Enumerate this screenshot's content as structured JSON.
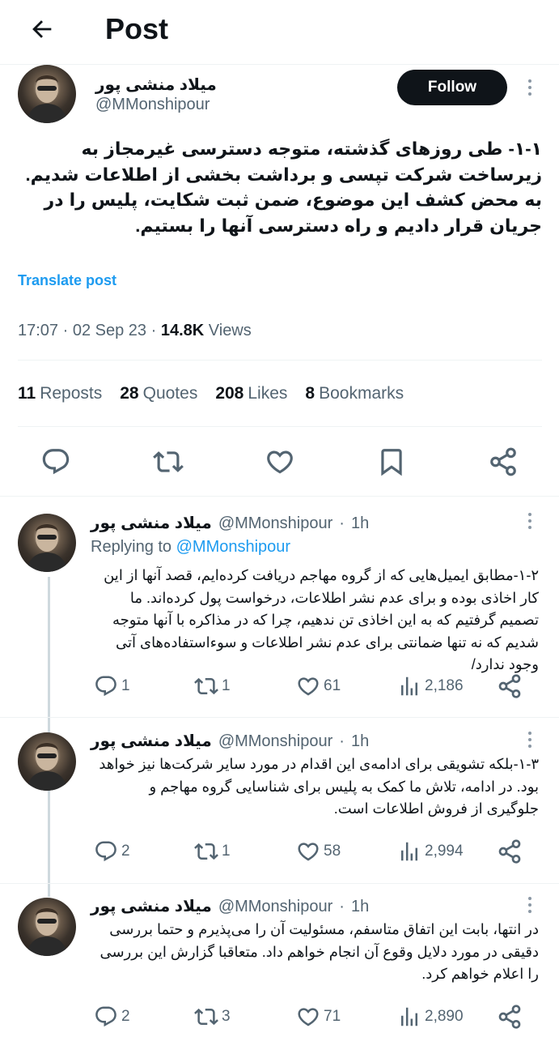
{
  "header": {
    "title": "Post",
    "back_icon": "arrow-left-icon"
  },
  "main_post": {
    "author_name": "میلاد منشی پور",
    "handle": "@MMonshipour",
    "follow_label": "Follow",
    "text": "۱-۱- طی روزهای گذشته، متوجه دسترسی غیرمجاز به زیرساخت شرکت تپسی و برداشت بخشی از اطلاعات شدیم. به محض کشف این موضوع، ضمن ثبت شکایت، پلیس را در جریان قرار دادیم و راه دسترسی آنها را بستیم.",
    "translate_label": "Translate post",
    "time": "17:07",
    "date": "02 Sep 23",
    "views_count": "14.8K",
    "views_label": "Views",
    "stats": {
      "reposts_count": "11",
      "reposts_label": "Reposts",
      "quotes_count": "28",
      "quotes_label": "Quotes",
      "likes_count": "208",
      "likes_label": "Likes",
      "bookmarks_count": "8",
      "bookmarks_label": "Bookmarks"
    }
  },
  "replies": [
    {
      "author_name": "میلاد منشی پور",
      "handle": "@MMonshipour",
      "age": "1h",
      "replying_label": "Replying to",
      "replying_handle": "@MMonshipour",
      "text": "۱-۲-مطابق ایمیل‌هایی که از گروه مهاجم دریافت کرده‌ایم، قصد آنها از این کار اخاذی بوده و برای عدم نشر اطلاعات، درخواست پول کرده‌اند. ما تصمیم گرفتیم که به این اخاذی تن ندهیم، چرا که در مذاکره با آنها متوجه شدیم که نه تنها ضمانتی برای عدم نشر اطلاعات و سوءاستفاده‌های آتی وجود ندارد/",
      "replies": "1",
      "reposts": "1",
      "likes": "61",
      "views": "2,186"
    },
    {
      "author_name": "میلاد منشی پور",
      "handle": "@MMonshipour",
      "age": "1h",
      "text": "۱-۳-بلکه تشویقی برای ادامه‌ی این اقدام در مورد سایر شرکت‌ها نیز خواهد بود. در ادامه، تلاش ما کمک به پلیس برای شناسایی گروه مهاجم و جلوگیری از فروش اطلاعات است.",
      "replies": "2",
      "reposts": "1",
      "likes": "58",
      "views": "2,994"
    },
    {
      "author_name": "میلاد منشی پور",
      "handle": "@MMonshipour",
      "age": "1h",
      "text": "در انتها، بابت این اتفاق متاسفم، مسئولیت آن را می‌پذیرم و حتما بررسی دقیقی در مورد دلایل وقوع آن انجام خواهم داد. متعاقبا گزارش این بررسی را اعلام خواهم کرد.",
      "replies": "2",
      "reposts": "3",
      "likes": "71",
      "views": "2,890"
    }
  ],
  "colors": {
    "accent": "#1d9bf0",
    "text": "#0f1419",
    "muted": "#536471",
    "border": "#eff3f4",
    "thread_line": "#cfd9de"
  }
}
